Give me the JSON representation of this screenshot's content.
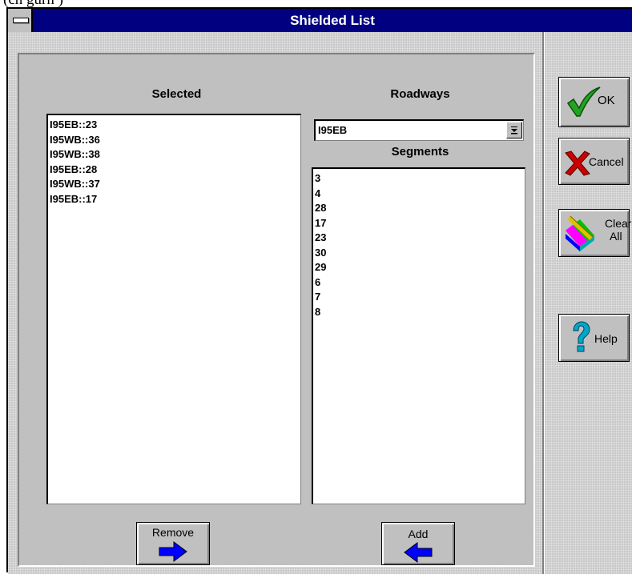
{
  "window": {
    "caption_fragment": "(cn   gurn )",
    "title": "Shielded List"
  },
  "selected": {
    "label": "Selected",
    "items": [
      "I95EB::23",
      "I95WB::36",
      "I95WB::38",
      "I95EB::28",
      "I95WB::37",
      "I95EB::17"
    ]
  },
  "roadways": {
    "label": "Roadways",
    "value": "I95EB"
  },
  "segments": {
    "label": "Segments",
    "items": [
      "3",
      "4",
      "28",
      "17",
      "23",
      "30",
      "29",
      "6",
      "7",
      "8"
    ]
  },
  "buttons": {
    "ok": "OK",
    "cancel": "Cancel",
    "clear_line1": "Clear",
    "clear_line2": "All",
    "help": "Help",
    "remove": "Remove",
    "add": "Add"
  },
  "icons": {
    "ok": "checkmark-icon",
    "cancel": "red-x-icon",
    "clear": "eraser-icon",
    "help": "question-mark-icon",
    "remove": "arrow-right-icon",
    "add": "arrow-left-icon",
    "dropdown": "arrow-down-icon"
  },
  "colors": {
    "titlebar": "#000080",
    "face": "#c0c0c0",
    "arrow": "#0000ff",
    "ok_check": "#22a322",
    "cancel_x": "#cc0000"
  }
}
